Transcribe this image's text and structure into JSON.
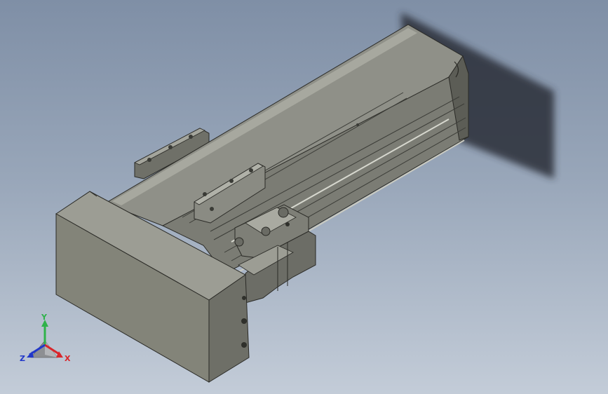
{
  "viewport": {
    "background_top": "#7f8fa6",
    "background_bottom": "#c3ccd8"
  },
  "model": {
    "body_color": "#8e8f86",
    "dark_color": "#55564f",
    "shadow_color": "#2b2f38"
  },
  "triad": {
    "x_label": "X",
    "y_label": "Y",
    "z_label": "Z",
    "x_color": "#d9262b",
    "y_color": "#2fb24a",
    "z_color": "#2238c9"
  }
}
